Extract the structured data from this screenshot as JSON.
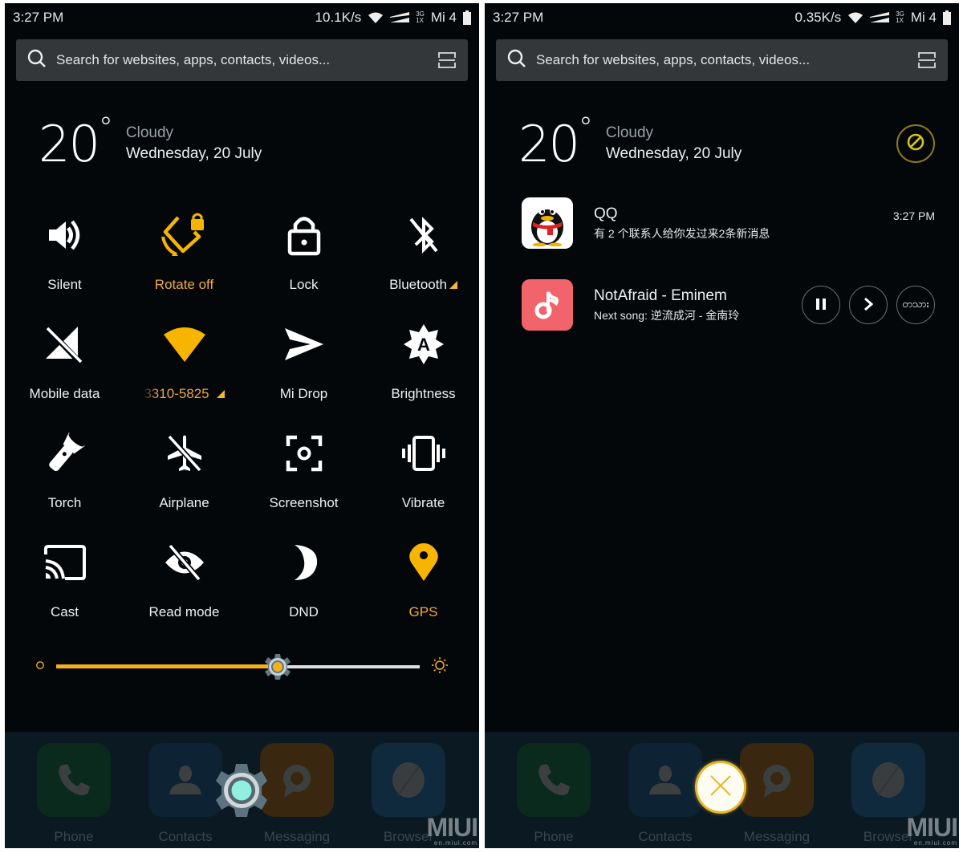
{
  "left_screen": {
    "status_bar": {
      "time": "3:27 PM",
      "speed": "10.1K/s",
      "network_top": "3G",
      "network_bottom": "1X",
      "carrier": "Mi 4"
    },
    "search": {
      "placeholder": "Search for websites, apps, contacts, videos..."
    },
    "weather": {
      "temp": "20",
      "degree": "°",
      "condition": "Cloudy",
      "date": "Wednesday, 20 July"
    },
    "toggles": [
      {
        "label": "Silent",
        "icon": "speaker-icon",
        "active": false
      },
      {
        "label": "Rotate off",
        "icon": "rotate-lock-icon",
        "active": true
      },
      {
        "label": "Lock",
        "icon": "padlock-icon",
        "active": false
      },
      {
        "label": "Bluetooth",
        "icon": "bluetooth-off-icon",
        "active": false,
        "has_more": true
      },
      {
        "label": "Mobile data",
        "icon": "mobile-data-off-icon",
        "active": false
      },
      {
        "label": "3310-5825",
        "icon": "wifi-icon",
        "active": true,
        "has_more": true
      },
      {
        "label": "Mi Drop",
        "icon": "send-icon",
        "active": false
      },
      {
        "label": "Brightness",
        "icon": "auto-brightness-icon",
        "active": false
      },
      {
        "label": "Torch",
        "icon": "flashlight-icon",
        "active": false
      },
      {
        "label": "Airplane",
        "icon": "airplane-off-icon",
        "active": false
      },
      {
        "label": "Screenshot",
        "icon": "screenshot-icon",
        "active": false
      },
      {
        "label": "Vibrate",
        "icon": "vibrate-icon",
        "active": false
      },
      {
        "label": "Cast",
        "icon": "cast-icon",
        "active": false
      },
      {
        "label": "Read mode",
        "icon": "eye-off-icon",
        "active": false
      },
      {
        "label": "DND",
        "icon": "moon-icon",
        "active": false
      },
      {
        "label": "GPS",
        "icon": "location-pin-icon",
        "active": true
      }
    ],
    "brightness": {
      "level_percent": 61
    },
    "dock": [
      {
        "label": "Phone",
        "icon": "phone-icon"
      },
      {
        "label": "Contacts",
        "icon": "contact-icon"
      },
      {
        "label": "Messaging",
        "icon": "message-icon"
      },
      {
        "label": "Browser",
        "icon": "browser-icon"
      }
    ],
    "overlay_icon": "settings-gear-icon"
  },
  "right_screen": {
    "status_bar": {
      "time": "3:27 PM",
      "speed": "0.35K/s",
      "network_top": "3G",
      "network_bottom": "1X",
      "carrier": "Mi 4"
    },
    "search": {
      "placeholder": "Search for websites, apps, contacts, videos..."
    },
    "weather": {
      "temp": "20",
      "degree": "°",
      "condition": "Cloudy",
      "date": "Wednesday, 20 July"
    },
    "notifications": [
      {
        "app": "QQ",
        "title": "QQ",
        "text": "有 2 个联系人给你发过来2条新消息",
        "time": "3:27 PM"
      },
      {
        "app": "Music",
        "title": "NotAfraid - Eminem",
        "text": "Next song: 逆流成河 - 金南玲",
        "buttons": [
          "pause",
          "next",
          "more"
        ],
        "more_label": "တသား"
      }
    ],
    "dock": [
      {
        "label": "Phone",
        "icon": "phone-icon"
      },
      {
        "label": "Contacts",
        "icon": "contact-icon"
      },
      {
        "label": "Messaging",
        "icon": "message-icon"
      },
      {
        "label": "Browser",
        "icon": "browser-icon"
      }
    ],
    "overlay_icon": "close-icon"
  },
  "watermark": {
    "logo": "MIUI",
    "url": "en.miui.com"
  },
  "colors": {
    "accent": "#f4b01d",
    "active_label": "#f1a93b",
    "background": "#03070a",
    "search_bg": "#33373a",
    "music_icon_bg": "#f2646b"
  }
}
